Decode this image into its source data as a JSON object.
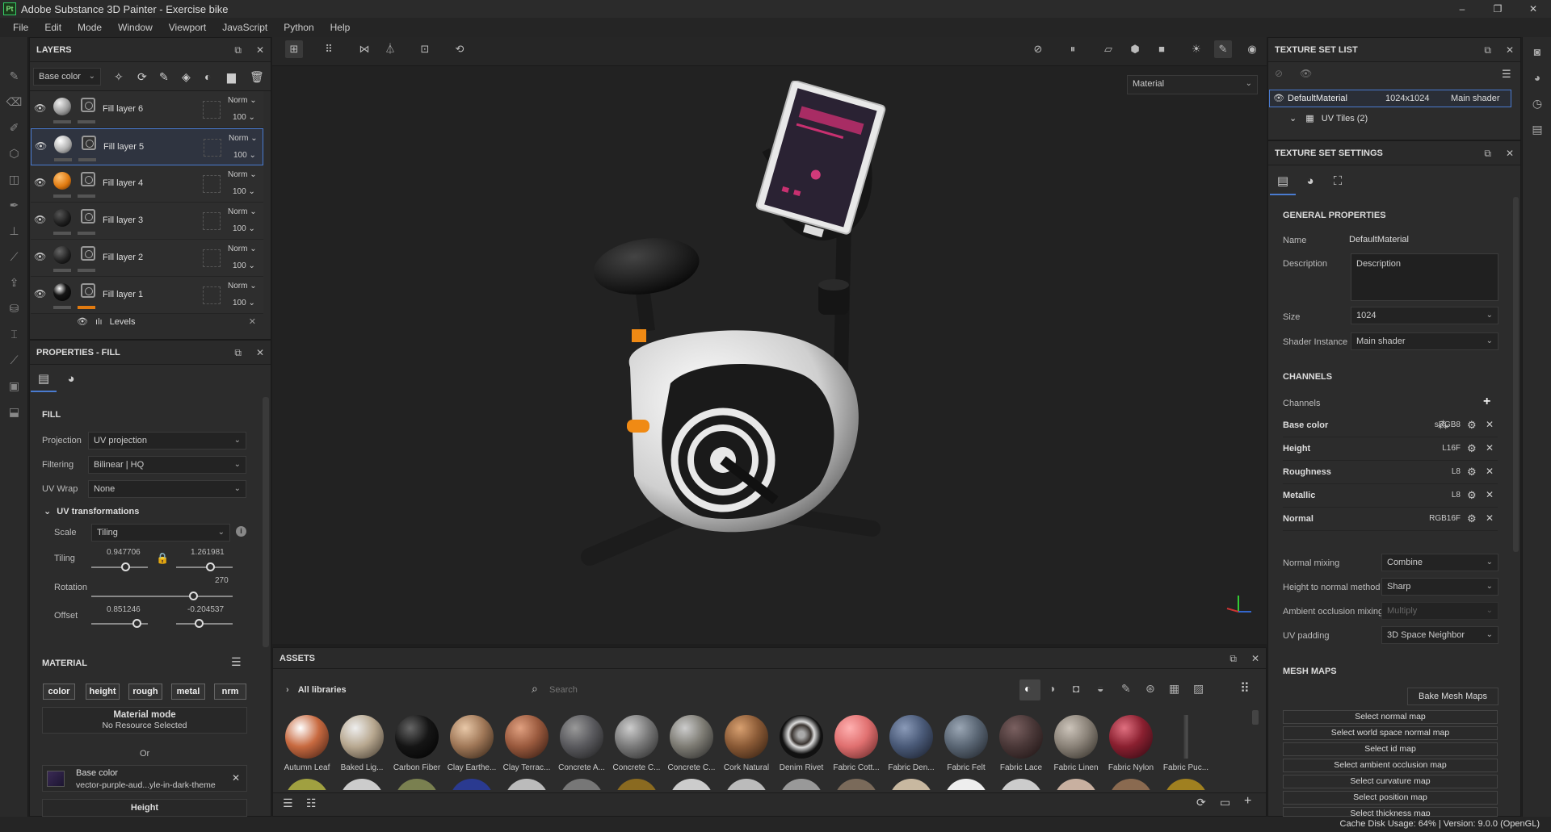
{
  "app": {
    "title": "Adobe Substance 3D Painter - Exercise bike",
    "logo": "Pt",
    "window_controls": [
      "–",
      "❐",
      "✕"
    ]
  },
  "menu": [
    "File",
    "Edit",
    "Mode",
    "Window",
    "Viewport",
    "JavaScript",
    "Python",
    "Help"
  ],
  "layers": {
    "title": "LAYERS",
    "channel_select": "Base color",
    "items": [
      {
        "name": "Fill layer 6",
        "blend": "Norm",
        "opacity": "100",
        "ball_color": "#9a9a9a"
      },
      {
        "name": "Fill layer 5",
        "blend": "Norm",
        "opacity": "100",
        "ball_color": "#b0b0b0"
      },
      {
        "name": "Fill layer 4",
        "blend": "Norm",
        "opacity": "100",
        "ball_color": "#e07a10"
      },
      {
        "name": "Fill layer 3",
        "blend": "Norm",
        "opacity": "100",
        "ball_color": "#1e1e1e"
      },
      {
        "name": "Fill layer 2",
        "blend": "Norm",
        "opacity": "100",
        "ball_color": "#222222"
      },
      {
        "name": "Fill layer 1",
        "blend": "Norm",
        "opacity": "100",
        "ball_color": "#151515"
      }
    ],
    "effect": "Levels"
  },
  "properties": {
    "title": "PROPERTIES - FILL",
    "section_fill": "FILL",
    "projection_label": "Projection",
    "projection_value": "UV projection",
    "filtering_label": "Filtering",
    "filtering_value": "Bilinear | HQ",
    "uvwrap_label": "UV Wrap",
    "uvwrap_value": "None",
    "uv_transform_title": "UV transformations",
    "scale_label": "Scale",
    "scale_value": "Tiling",
    "tiling_label": "Tiling",
    "tiling_u": "0.947706",
    "tiling_v": "1.261981",
    "rotation_label": "Rotation",
    "rotation_value": "270",
    "offset_label": "Offset",
    "offset_u": "0.851246",
    "offset_v": "-0.204537",
    "material_title": "MATERIAL",
    "material_tags": [
      "color",
      "height",
      "rough",
      "metal",
      "nrm"
    ],
    "material_mode_label": "Material mode",
    "material_mode_value": "No Resource Selected",
    "or_label": "Or",
    "base_color_label": "Base color",
    "base_color_resource": "vector-purple-aud...yle-in-dark-theme",
    "height_label": "Height"
  },
  "viewport": {
    "display_mode": "Material"
  },
  "assets": {
    "title": "ASSETS",
    "library": "All libraries",
    "search_placeholder": "Search",
    "items": [
      {
        "name": "Autumn Leaf",
        "color": "#c86a40"
      },
      {
        "name": "Baked Lig...",
        "color": "#b8a890"
      },
      {
        "name": "Carbon Fiber",
        "color": "#151515"
      },
      {
        "name": "Clay Earthe...",
        "color": "#a07858"
      },
      {
        "name": "Clay Terrac...",
        "color": "#9a5a3e"
      },
      {
        "name": "Concrete A...",
        "color": "#5a5a5e"
      },
      {
        "name": "Concrete C...",
        "color": "#7a7a7a"
      },
      {
        "name": "Concrete C...",
        "color": "#7e7c74"
      },
      {
        "name": "Cork Natural",
        "color": "#8a5a36"
      },
      {
        "name": "Denim Rivet",
        "color": "#3a3430"
      },
      {
        "name": "Fabric Cott...",
        "color": "#e07070"
      },
      {
        "name": "Fabric Den...",
        "color": "#4a5a78"
      },
      {
        "name": "Fabric Felt",
        "color": "#5a6674"
      },
      {
        "name": "Fabric Lace",
        "color": "#4a3838"
      },
      {
        "name": "Fabric Linen",
        "color": "#8a8278"
      },
      {
        "name": "Fabric Nylon",
        "color": "#8a2030"
      },
      {
        "name": "Fabric Puc...",
        "color": "#3a3a3a"
      }
    ]
  },
  "texture_set_list": {
    "title": "TEXTURE SET LIST",
    "material": "DefaultMaterial",
    "resolution": "1024x1024",
    "shader": "Main shader",
    "uv_tiles": "UV Tiles (2)"
  },
  "texture_set_settings": {
    "title": "TEXTURE SET SETTINGS",
    "general_title": "GENERAL PROPERTIES",
    "name_label": "Name",
    "name_value": "DefaultMaterial",
    "description_label": "Description",
    "description_value": "Description",
    "size_label": "Size",
    "size_value": "1024",
    "shader_label": "Shader Instance",
    "shader_value": "Main shader",
    "channels_title": "CHANNELS",
    "channels_label": "Channels",
    "channels": [
      {
        "name": "Base color",
        "format": "sRGB8"
      },
      {
        "name": "Height",
        "format": "L16F"
      },
      {
        "name": "Roughness",
        "format": "L8"
      },
      {
        "name": "Metallic",
        "format": "L8"
      },
      {
        "name": "Normal",
        "format": "RGB16F"
      }
    ],
    "normal_mixing_label": "Normal mixing",
    "normal_mixing_value": "Combine",
    "height_normal_label": "Height to normal method",
    "height_normal_value": "Sharp",
    "ao_mixing_label": "Ambient occlusion mixing",
    "ao_mixing_value": "Multiply",
    "uv_padding_label": "UV padding",
    "uv_padding_value": "3D Space Neighbor",
    "mesh_maps_title": "MESH MAPS",
    "bake_button": "Bake Mesh Maps",
    "mesh_maps": [
      "Select normal map",
      "Select world space normal map",
      "Select id map",
      "Select ambient occlusion map",
      "Select curvature map",
      "Select position map",
      "Select thickness map"
    ]
  },
  "status": {
    "cache": "Cache Disk Usage:",
    "cache_value": "64%",
    "version": "| Version: 9.0.0 (OpenGL)"
  }
}
